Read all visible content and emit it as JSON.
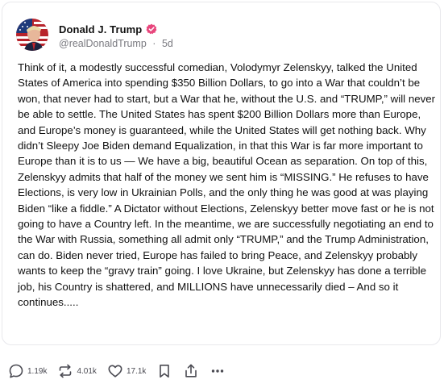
{
  "post": {
    "author": {
      "display_name": "Donald J. Trump",
      "handle": "@realDonaldTrump",
      "separator": "·",
      "time_ago": "5d",
      "verified_color": "#e8467c"
    },
    "text": "Think of it, a modestly successful comedian, Volodymyr Zelenskyy, talked the United States of America into spending $350 Billion Dollars, to go into a War that couldn’t be won, that never had to start, but a War that he, without the U.S. and “TRUMP,” will never be able to settle. The United States has spent $200 Billion Dollars more than Europe, and Europe’s money is guaranteed, while the United States will get nothing back. Why didn’t Sleepy Joe Biden demand Equalization, in that this War is far more important to Europe than it is to us — We have a big, beautiful Ocean as separation. On top of this, Zelenskyy admits that half of the money we sent him is “MISSING.” He refuses to have Elections, is very low in Ukrainian Polls, and the only thing he was good at was playing Biden “like a fiddle.” A Dictator without Elections, Zelenskyy better move fast or he is not going to have a Country left. In the meantime, we are successfully negotiating an end to the War with Russia, something all admit only “TRUMP,” and the Trump Administration, can do. Biden never tried, Europe has failed to bring Peace, and Zelenskyy probably wants to keep the “gravy train” going. I love Ukraine, but Zelenskyy has done a terrible job, his Country is shattered, and MILLIONS have unnecessarily died – And so it continues.....",
    "actions": {
      "replies": "1.19k",
      "retruths": "4.01k",
      "likes": "17.1k"
    },
    "icons": [
      "reply-icon",
      "retruth-icon",
      "like-icon",
      "bookmark-icon",
      "share-icon",
      "more-icon"
    ]
  }
}
